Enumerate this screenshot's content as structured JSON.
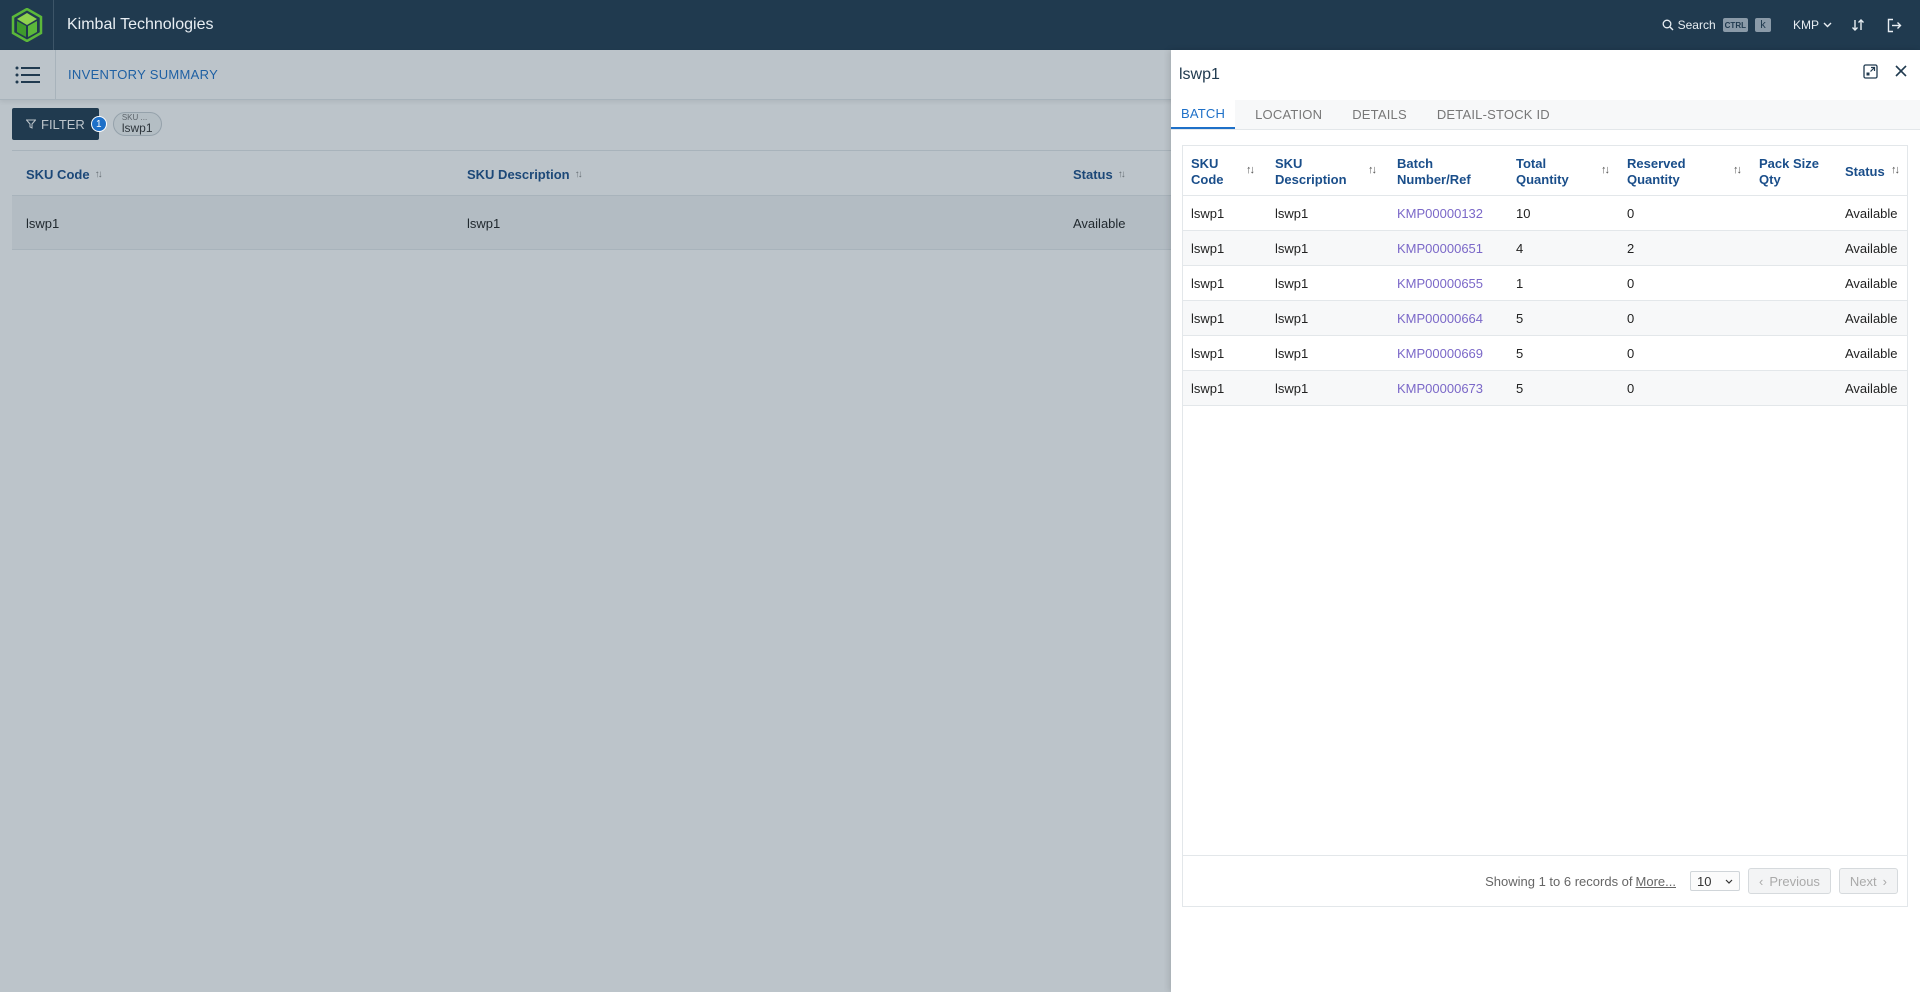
{
  "app": {
    "brand": "Kimbal Technologies",
    "search_label": "Search",
    "kbd_ctrl": "CTRL",
    "kbd_k": "k",
    "org": "KMP"
  },
  "page": {
    "title": "INVENTORY SUMMARY",
    "filter_label": "FILTER",
    "filter_count": "1",
    "chip": {
      "label": "SKU ...",
      "value": "lswp1"
    },
    "table": {
      "columns": [
        "SKU Code",
        "SKU Description",
        "Status"
      ],
      "rows": [
        {
          "sku": "lswp1",
          "desc": "lswp1",
          "status": "Available"
        }
      ]
    }
  },
  "drawer": {
    "title": "lswp1",
    "tabs": [
      "BATCH",
      "LOCATION",
      "DETAILS",
      "DETAIL-STOCK ID"
    ],
    "active_tab": "BATCH",
    "columns": {
      "sku_code": [
        "SKU",
        "Code"
      ],
      "sku_desc": [
        "SKU",
        "Description"
      ],
      "batch": [
        "Batch",
        "Number/Ref"
      ],
      "total": [
        "Total",
        "Quantity"
      ],
      "reserved": [
        "Reserved",
        "Quantity"
      ],
      "pack": [
        "Pack Size",
        "Qty"
      ],
      "status": [
        "Status"
      ]
    },
    "rows": [
      {
        "sku": "lswp1",
        "desc": "lswp1",
        "batch": "KMP00000132",
        "total": "10",
        "reserved": "0",
        "pack": "",
        "status": "Available"
      },
      {
        "sku": "lswp1",
        "desc": "lswp1",
        "batch": "KMP00000651",
        "total": "4",
        "reserved": "2",
        "pack": "",
        "status": "Available"
      },
      {
        "sku": "lswp1",
        "desc": "lswp1",
        "batch": "KMP00000655",
        "total": "1",
        "reserved": "0",
        "pack": "",
        "status": "Available"
      },
      {
        "sku": "lswp1",
        "desc": "lswp1",
        "batch": "KMP00000664",
        "total": "5",
        "reserved": "0",
        "pack": "",
        "status": "Available"
      },
      {
        "sku": "lswp1",
        "desc": "lswp1",
        "batch": "KMP00000669",
        "total": "5",
        "reserved": "0",
        "pack": "",
        "status": "Available"
      },
      {
        "sku": "lswp1",
        "desc": "lswp1",
        "batch": "KMP00000673",
        "total": "5",
        "reserved": "0",
        "pack": "",
        "status": "Available"
      }
    ],
    "footer": {
      "showing": "Showing 1 to 6 records of",
      "more": "More...",
      "page_size": "10",
      "previous": "Previous",
      "next": "Next"
    }
  },
  "colors": {
    "topbar": "#203a4f",
    "accent": "#1e70c8",
    "link": "#7b68c8",
    "header_text": "#1a4e8a",
    "logo_green": "#5cb83a"
  }
}
